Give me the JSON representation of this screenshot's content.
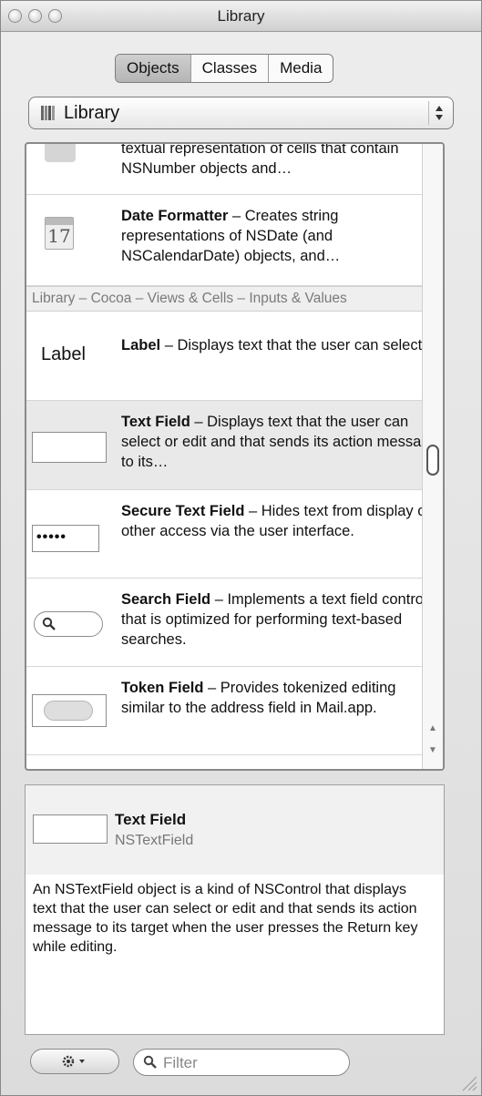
{
  "window": {
    "title": "Library"
  },
  "tabs": [
    "Objects",
    "Classes",
    "Media"
  ],
  "popup": {
    "label": "Library"
  },
  "list": {
    "partial_top": {
      "text": "textual representation of cells that contain NSNumber objects and…"
    },
    "date_formatter": {
      "icon_day": "17",
      "name": "Date Formatter",
      "desc": " – Creates string representations of NSDate (and NSCalendarDate) objects, and…"
    },
    "section_header": "Library – Cocoa – Views & Cells – Inputs & Values",
    "label_item": {
      "preview": "Label",
      "name": "Label",
      "desc": " – Displays text that the user can select"
    },
    "text_field": {
      "name": "Text Field",
      "desc": " – Displays text that the user can select or edit and that sends its action message to its…"
    },
    "secure_text_field": {
      "preview": "•••••",
      "name": "Secure Text Field",
      "desc": " – Hides text from display or other access via the user interface."
    },
    "search_field": {
      "name": "Search Field",
      "desc": " – Implements a text field control that is optimized for performing text-based searches."
    },
    "token_field": {
      "name": "Token Field",
      "desc": " – Provides tokenized editing similar to the address field in Mail.app."
    }
  },
  "detail": {
    "title": "Text Field",
    "class_name": "NSTextField",
    "description": "An NSTextField object is a kind of NSControl that displays text that the user can select or edit and that sends its action message to its target when the user presses the Return key while editing."
  },
  "bottom": {
    "filter_placeholder": "Filter"
  },
  "icons": [
    "gear-icon",
    "magnifier-icon",
    "library-icon",
    "calendar-icon",
    "resize-grip-icon"
  ]
}
